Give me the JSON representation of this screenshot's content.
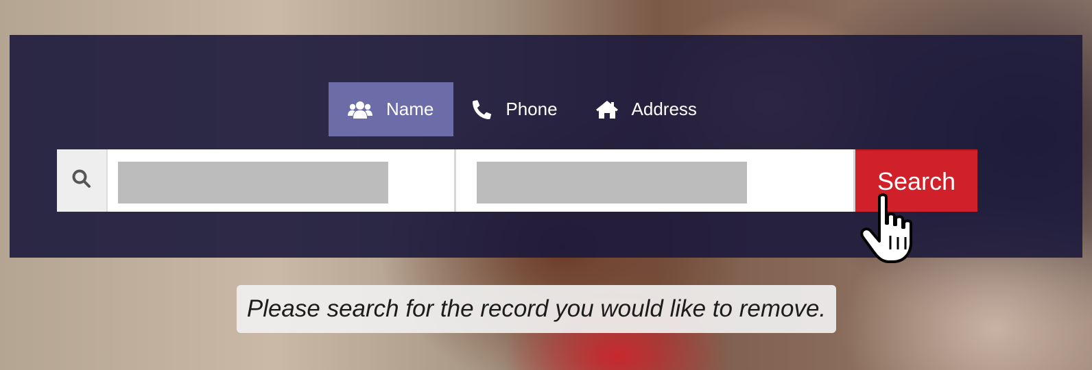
{
  "tabs": [
    {
      "label": "Name",
      "icon": "users-icon",
      "active": true
    },
    {
      "label": "Phone",
      "icon": "phone-icon",
      "active": false
    },
    {
      "label": "Address",
      "icon": "home-icon",
      "active": false
    }
  ],
  "search": {
    "icon": "search-icon",
    "field_1_value": "",
    "field_2_value": "",
    "button_label": "Search"
  },
  "message": "Please search for the record you would like to remove.",
  "colors": {
    "panel_bg": "#1c193c",
    "active_tab": "#6b6ca8",
    "search_button": "#d0202a",
    "redacted_field": "#bcbcbc"
  }
}
